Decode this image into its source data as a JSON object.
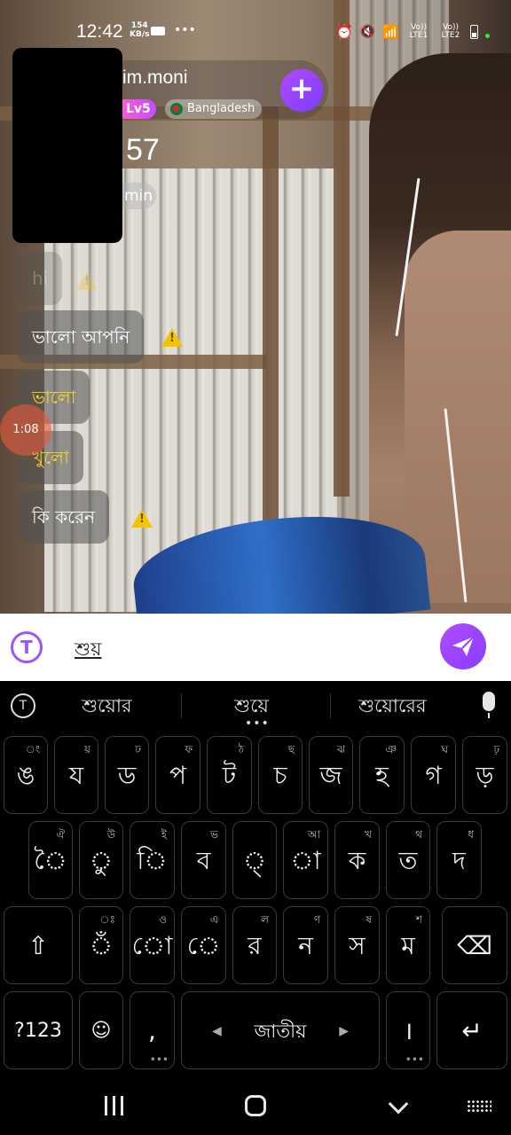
{
  "status_bar": {
    "time": "12:42",
    "speed_value": "154",
    "speed_unit": "KB/s",
    "sim1": "Vo)) LTE1",
    "sim2": "Vo)) LTE2",
    "notification_dots": "•••"
  },
  "stream": {
    "host_name": "im.moni",
    "level": "Lv5",
    "country": "Bangladesh",
    "viewer_count": "57",
    "time_chip": "min",
    "add_label": "+",
    "timer": "1:08"
  },
  "chat": {
    "messages": [
      {
        "text": "hi",
        "style": "faded"
      },
      {
        "text": "ভালো আপনি",
        "style": "normal"
      },
      {
        "text": "ভালো",
        "style": "yellow"
      },
      {
        "text": "খুলো",
        "style": "yellow"
      },
      {
        "text": "কি করেন",
        "style": "normal"
      }
    ]
  },
  "composer": {
    "logo_letter": "T",
    "input_value": "শুয়"
  },
  "keyboard": {
    "suggestions": [
      "শুয়োর",
      "শুয়ে",
      "শুয়োরের"
    ],
    "more_dots": "•••",
    "row1": [
      {
        "key": "ঙ",
        "hint": "ং"
      },
      {
        "key": "য",
        "hint": "য়"
      },
      {
        "key": "ড",
        "hint": "ঢ"
      },
      {
        "key": "প",
        "hint": "ফ"
      },
      {
        "key": "ট",
        "hint": "ঠ"
      },
      {
        "key": "চ",
        "hint": "ছ"
      },
      {
        "key": "জ",
        "hint": "ঝ"
      },
      {
        "key": "হ",
        "hint": "ঞ"
      },
      {
        "key": "গ",
        "hint": "ঘ"
      },
      {
        "key": "ড়",
        "hint": "ঢ়"
      }
    ],
    "row2": [
      {
        "key": "ৈ",
        "hint": "ঐ"
      },
      {
        "key": "ু",
        "hint": "উ"
      },
      {
        "key": "ি",
        "hint": "ই"
      },
      {
        "key": "ব",
        "hint": "ভ"
      },
      {
        "key": "্",
        "hint": ""
      },
      {
        "key": "া",
        "hint": "আ"
      },
      {
        "key": "ক",
        "hint": "খ"
      },
      {
        "key": "ত",
        "hint": "থ"
      },
      {
        "key": "দ",
        "hint": "ধ"
      }
    ],
    "row3": [
      {
        "key": "ঁ",
        "hint": "ঃ"
      },
      {
        "key": "ো",
        "hint": "ও"
      },
      {
        "key": "ে",
        "hint": "এ"
      },
      {
        "key": "র",
        "hint": "ল"
      },
      {
        "key": "ন",
        "hint": "ণ"
      },
      {
        "key": "স",
        "hint": "ষ"
      },
      {
        "key": "ম",
        "hint": "শ"
      }
    ],
    "symbols_label": "?123",
    "comma_label": ",",
    "space_label": "জাতীয়",
    "period_label": "।",
    "shift_glyph": "⇧",
    "backspace_glyph": "⌫",
    "enter_glyph": "↵",
    "emoji_glyph": "☺"
  }
}
